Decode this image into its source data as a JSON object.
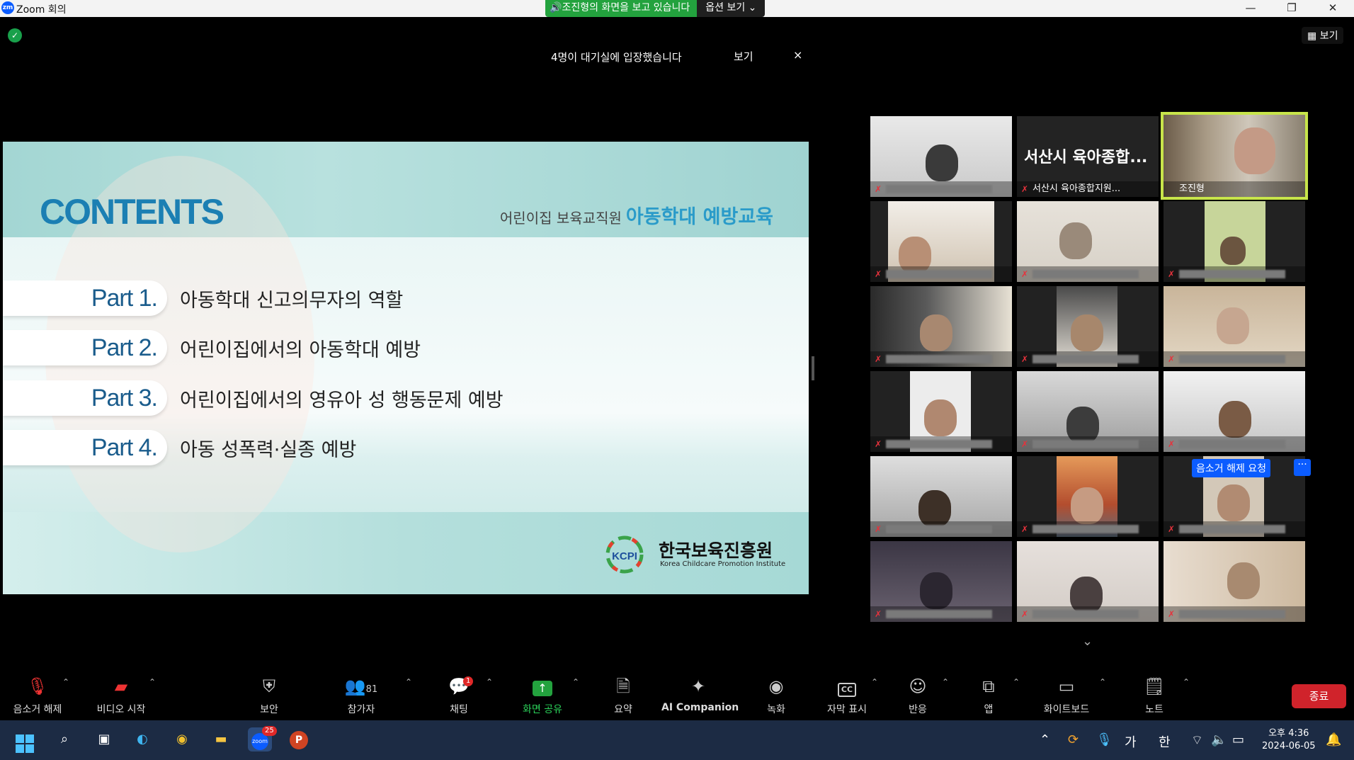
{
  "window": {
    "app_title": "Zoom 회의"
  },
  "share_banner": {
    "viewing": "조진형의 화면을 보고 있습니다",
    "view_options": "옵션 보기"
  },
  "top": {
    "view_button": "보기",
    "waiting_notice": "4명이 대기실에 입장했습니다",
    "notice_view": "보기",
    "notice_close": "×"
  },
  "slide": {
    "heading": "CONTENTS",
    "subtitle_prefix": "어린이집 보육교직원",
    "subtitle_highlight": "아동학대 예방교육",
    "parts": [
      {
        "label": "Part 1.",
        "text": "아동학대 신고의무자의 역할"
      },
      {
        "label": "Part 2.",
        "text": "어린이집에서의 아동학대 예방"
      },
      {
        "label": "Part 3.",
        "text": "어린이집에서의 영유아 성 행동문제 예방"
      },
      {
        "label": "Part 4.",
        "text": "아동 성폭력·실종 예방"
      }
    ],
    "logo_abbr": "KCPI",
    "org_name": "한국보육진흥원",
    "org_name_en": "Korea Childcare Promotion Institute"
  },
  "gallery": {
    "tile_2_big": "서산시 육아종합...",
    "tile_2_name": "서산시 육아종합지원...",
    "tile_3_name": "조진형",
    "unmute_request": "음소거 해제 요청",
    "more": "···"
  },
  "toolbar": {
    "mute": "음소거 해제",
    "video": "비디오 시작",
    "security": "보안",
    "participants": "참가자",
    "participants_count": "81",
    "chat": "채팅",
    "chat_badge": "1",
    "share": "화면 공유",
    "summary": "요약",
    "ai": "AI Companion",
    "record": "녹화",
    "captions": "자막 표시",
    "captions_icon": "CC",
    "reactions": "반응",
    "apps": "앱",
    "whiteboard": "화이트보드",
    "notes": "노트",
    "end": "종료"
  },
  "taskbar": {
    "zoom_badge": "25",
    "ime_ga": "가",
    "ime_han": "한",
    "time": "오후 4:36",
    "date": "2024-06-05"
  },
  "colors": {
    "accent": "#0b5cff",
    "share_green": "#23a23e",
    "end_red": "#d0232b",
    "active_speaker": "#c8e54a"
  }
}
